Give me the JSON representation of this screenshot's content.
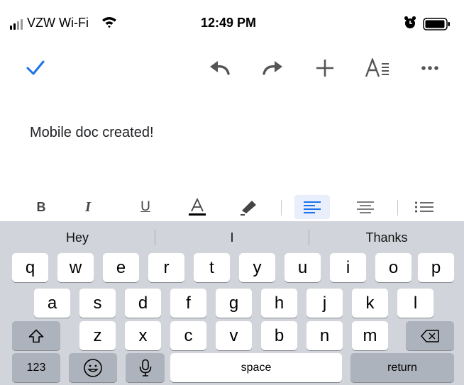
{
  "status_bar": {
    "carrier": "VZW Wi-Fi",
    "time": "12:49 PM"
  },
  "toolbar": {
    "icons": [
      "checkmark-icon",
      "undo-icon",
      "redo-icon",
      "add-icon",
      "text-format-icon",
      "more-icon"
    ],
    "accent_color": "#1a73e8"
  },
  "document": {
    "text": "Mobile doc created!"
  },
  "format_bar": {
    "bold": "B",
    "italic": "I",
    "underline": "U",
    "text_color": "A",
    "active_highlight": "#e8eefc",
    "active_color": "#1a73e8"
  },
  "keyboard": {
    "suggestions": [
      "Hey",
      "I",
      "Thanks"
    ],
    "row1": [
      "q",
      "w",
      "e",
      "r",
      "t",
      "y",
      "u",
      "i",
      "o",
      "p"
    ],
    "row2": [
      "a",
      "s",
      "d",
      "f",
      "g",
      "h",
      "j",
      "k",
      "l"
    ],
    "row3": [
      "z",
      "x",
      "c",
      "v",
      "b",
      "n",
      "m"
    ],
    "numbers_label": "123",
    "space_label": "space",
    "return_label": "return"
  }
}
